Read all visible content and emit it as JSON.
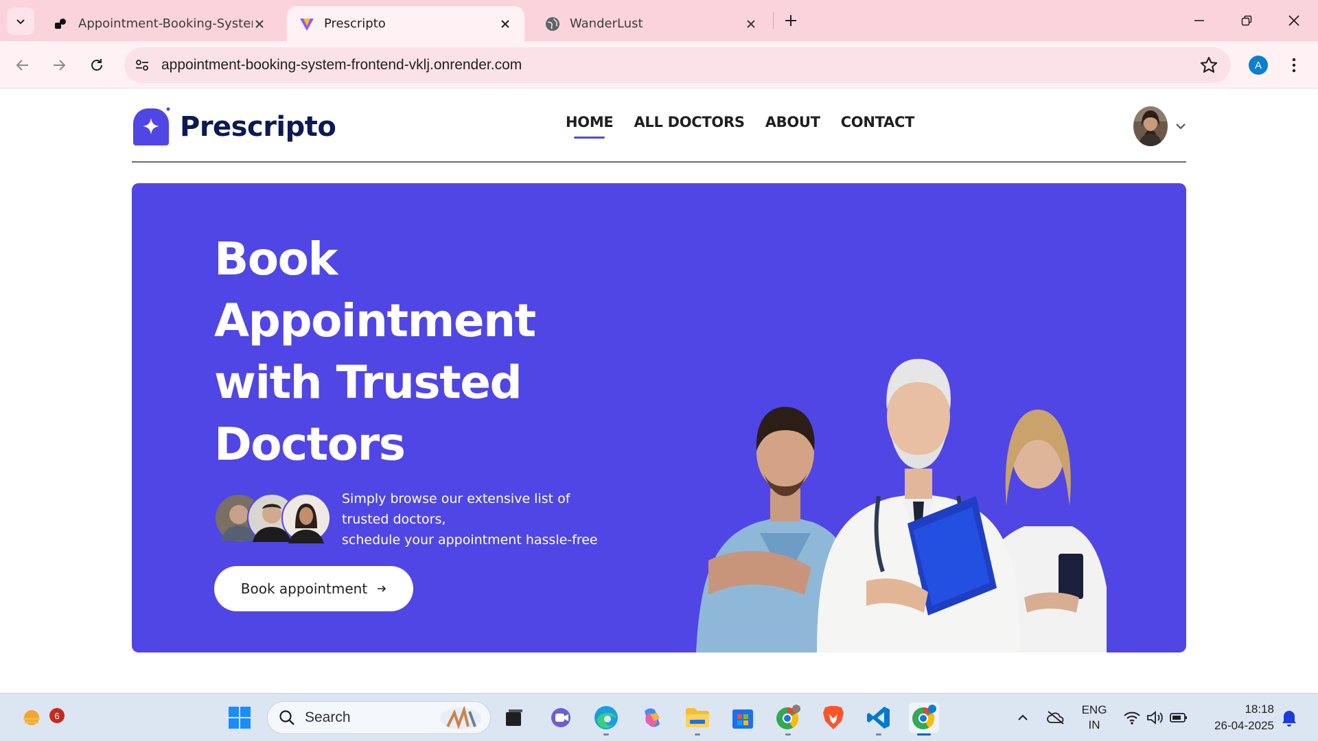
{
  "browser": {
    "tabs": [
      {
        "title": "Appointment-Booking-System-",
        "favicon": "github-like-icon"
      },
      {
        "title": "Prescripto",
        "favicon": "vite-icon"
      },
      {
        "title": "WanderLust",
        "favicon": "globe-icon"
      }
    ],
    "active_tab": 1,
    "url": "appointment-booking-system-frontend-vklj.onrender.com",
    "profile_initial": "A"
  },
  "site": {
    "brand": "Prescripto",
    "nav": [
      "HOME",
      "ALL DOCTORS",
      "ABOUT",
      "CONTACT"
    ],
    "active_nav": "HOME",
    "accent": "#5046e5"
  },
  "hero": {
    "title_lines": [
      "Book",
      "Appointment",
      "with Trusted",
      "Doctors"
    ],
    "desc_line1": "Simply browse our extensive list of trusted doctors,",
    "desc_line2": "schedule your appointment hassle-free",
    "cta_label": "Book appointment",
    "cta_icon": "arrow-right-icon",
    "background": "#5046e5"
  },
  "taskbar": {
    "weather_badge": "6",
    "search_label": "Search",
    "lang_line1": "ENG",
    "lang_line2": "IN",
    "time": "18:18",
    "date": "26-04-2025"
  }
}
